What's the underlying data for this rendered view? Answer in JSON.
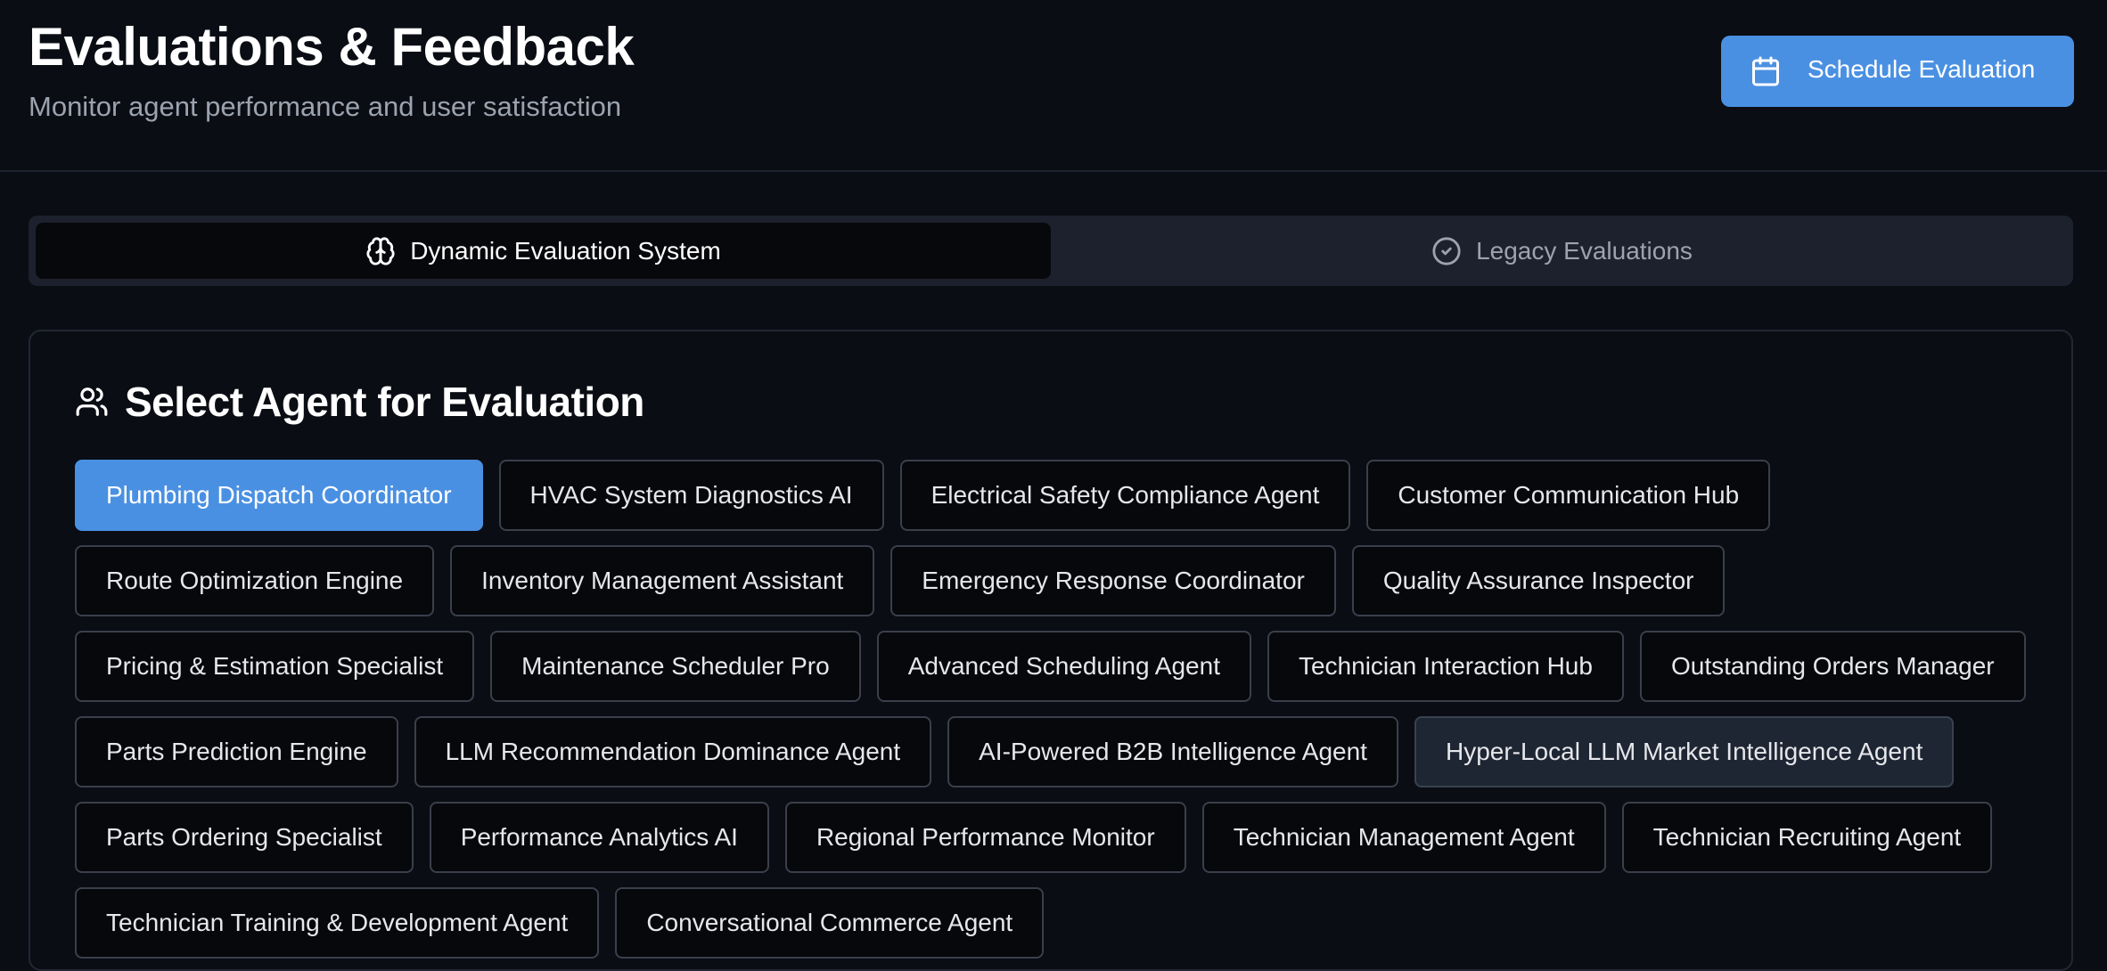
{
  "header": {
    "title": "Evaluations & Feedback",
    "subtitle": "Monitor agent performance and user satisfaction",
    "schedule_button": {
      "label": "Schedule Evaluation",
      "icon": "calendar-icon"
    }
  },
  "tabs": [
    {
      "label": "Dynamic Evaluation System",
      "icon": "brain-icon",
      "active": true
    },
    {
      "label": "Legacy Evaluations",
      "icon": "check-circle-icon",
      "active": false
    }
  ],
  "agent_selector": {
    "title": "Select Agent for Evaluation",
    "icon": "users-icon",
    "selected": "Plumbing Dispatch Coordinator",
    "agents": [
      "Plumbing Dispatch Coordinator",
      "HVAC System Diagnostics AI",
      "Electrical Safety Compliance Agent",
      "Customer Communication Hub",
      "Route Optimization Engine",
      "Inventory Management Assistant",
      "Emergency Response Coordinator",
      "Quality Assurance Inspector",
      "Pricing & Estimation Specialist",
      "Maintenance Scheduler Pro",
      "Advanced Scheduling Agent",
      "Technician Interaction Hub",
      "Outstanding Orders Manager",
      "Parts Prediction Engine",
      "LLM Recommendation Dominance Agent",
      "AI-Powered B2B Intelligence Agent",
      "Hyper-Local LLM Market Intelligence Agent",
      "Parts Ordering Specialist",
      "Performance Analytics AI",
      "Regional Performance Monitor",
      "Technician Management Agent",
      "Technician Recruiting Agent",
      "Technician Training & Development Agent",
      "Conversational Commerce Agent"
    ]
  },
  "colors": {
    "background": "#0b0d14",
    "accent": "#4a90e2",
    "muted_text": "#9ca3af"
  }
}
